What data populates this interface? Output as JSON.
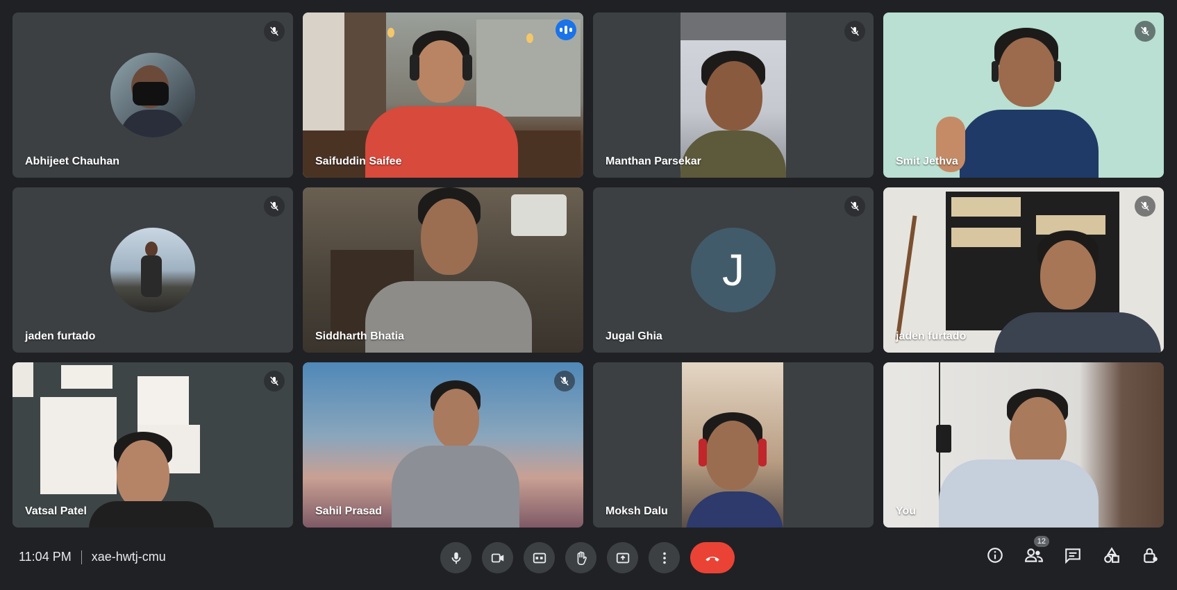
{
  "participants": [
    {
      "name": "Abhijeet Chauhan",
      "muted": true
    },
    {
      "name": "Saifuddin Saifee",
      "speaking": true
    },
    {
      "name": "Manthan Parsekar",
      "muted": true
    },
    {
      "name": "Smit Jethva",
      "muted": true
    },
    {
      "name": "jaden furtado",
      "muted": true
    },
    {
      "name": "Siddharth Bhatia"
    },
    {
      "name": "Jugal Ghia",
      "muted": true,
      "initial": "J"
    },
    {
      "name": "jaden furtado",
      "muted": true
    },
    {
      "name": "Vatsal Patel",
      "muted": true
    },
    {
      "name": "Sahil Prasad",
      "muted": true
    },
    {
      "name": "Moksh Dalu"
    },
    {
      "name": "You"
    }
  ],
  "footer": {
    "time": "11:04 PM",
    "meeting_code": "xae-hwtj-cmu",
    "people_count": "12"
  },
  "controls": {
    "center": [
      "mic-icon",
      "camera-icon",
      "captions-icon",
      "raise-hand-icon",
      "present-icon",
      "more-options-icon",
      "end-call-icon"
    ],
    "right": [
      "info-icon",
      "people-icon",
      "chat-icon",
      "activities-icon",
      "host-controls-icon"
    ]
  },
  "colors": {
    "background": "#202124",
    "tile": "#3c4043",
    "active_outline": "#8ab4f8",
    "end_call": "#ea4335",
    "avatar_letter_bg": "#425b6a"
  }
}
